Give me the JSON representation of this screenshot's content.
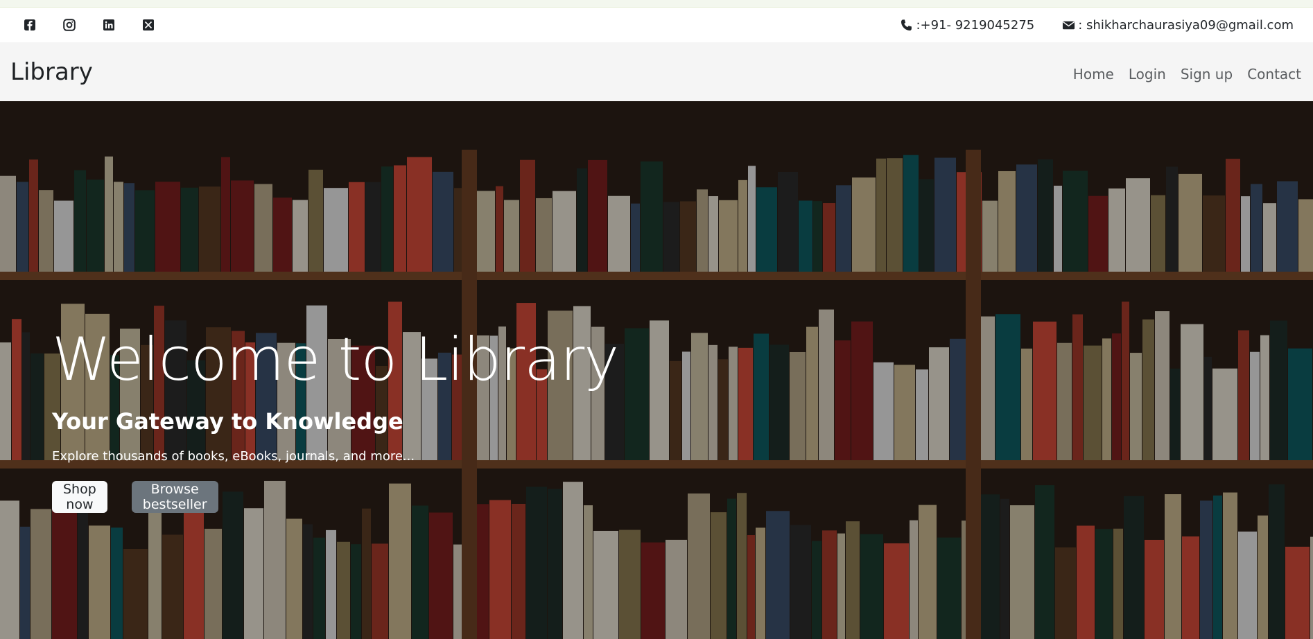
{
  "topbar": {
    "socials": [
      {
        "icon": "facebook-icon"
      },
      {
        "icon": "instagram-icon"
      },
      {
        "icon": "linkedin-icon"
      },
      {
        "icon": "x-twitter-icon"
      }
    ],
    "phone": ":+91- 9219045275",
    "email": ": shikharchaurasiya09@gmail.com"
  },
  "navbar": {
    "brand": "Library",
    "links": [
      "Home",
      "Login",
      "Sign up",
      "Contact"
    ]
  },
  "hero": {
    "title": "Welcome to Library",
    "subtitle": "Your Gateway to Knowledge",
    "description": "Explore thousands of books, eBooks, journals, and more...",
    "primary_button": "Shop now",
    "secondary_button": "Browse bestseller"
  },
  "colors": {
    "navbar_bg": "#f5f5f5",
    "hero_overlay": "#000000",
    "button_light": "#f8f9fa",
    "button_secondary": "#6c757d",
    "shelf_wood": "#7a4a2a"
  }
}
